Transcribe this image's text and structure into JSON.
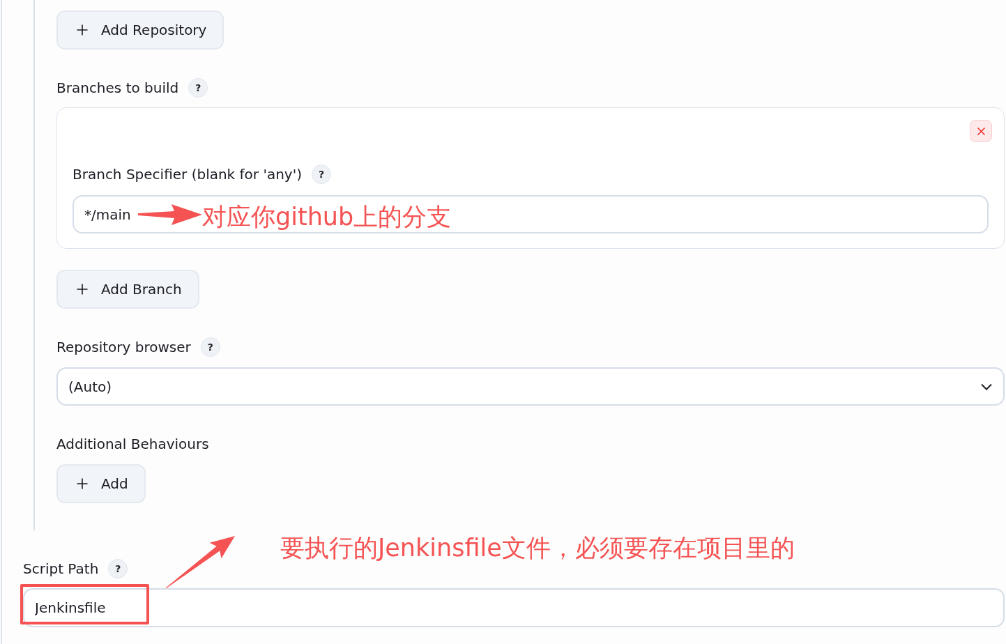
{
  "repositories": {
    "add_button": "Add Repository"
  },
  "branches": {
    "label": "Branches to build",
    "help": "?",
    "items": [
      {
        "label": "Branch Specifier (blank for 'any')",
        "help": "?",
        "value": "*/main",
        "annotation": {
          "kind": "inline",
          "text": "对应你github上的分支"
        }
      }
    ],
    "add_button": "Add Branch"
  },
  "repository_browser": {
    "label": "Repository browser",
    "help": "?",
    "value": "(Auto)"
  },
  "additional_behaviours": {
    "label": "Additional Behaviours",
    "add_button": "Add"
  },
  "script_path": {
    "label": "Script Path",
    "help": "?",
    "value": "Jenkinsfile",
    "annotation": {
      "kind": "callout",
      "text": "要执行的Jenkinsfile文件，必须要存在项目里的",
      "highlight": true
    }
  }
}
